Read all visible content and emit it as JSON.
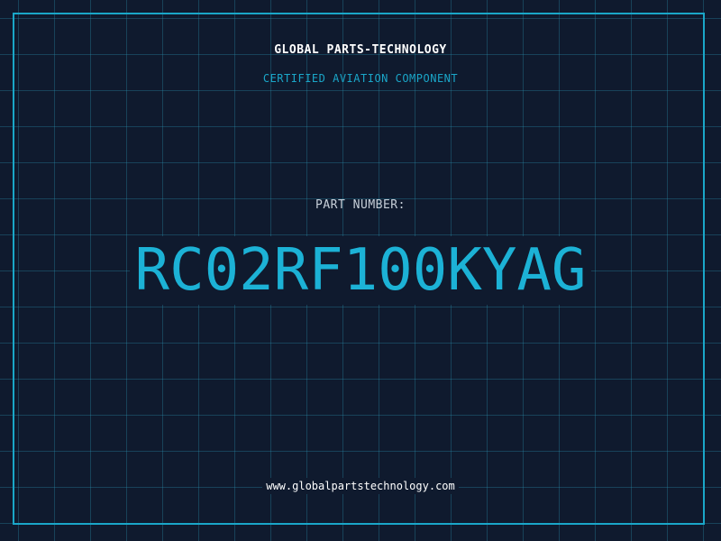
{
  "header": {
    "company": "GLOBAL PARTS-TECHNOLOGY",
    "subtitle": "CERTIFIED AVIATION COMPONENT"
  },
  "part": {
    "label": "PART NUMBER:",
    "number": "RC02RF100KYAG"
  },
  "footer": {
    "website": "www.globalpartstechnology.com"
  },
  "colors": {
    "background": "#0f1a2e",
    "accent": "#1aa6c8",
    "text": "#ffffff"
  }
}
